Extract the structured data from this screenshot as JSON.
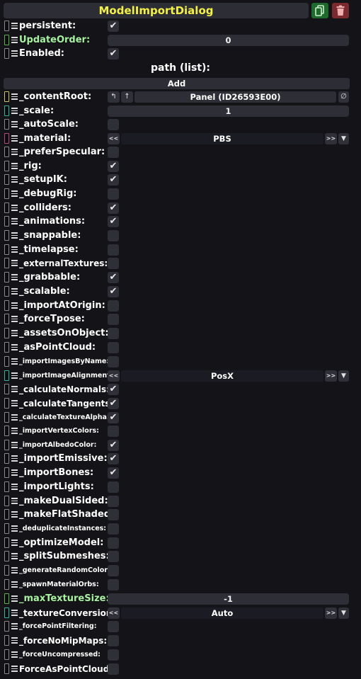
{
  "header": {
    "title": "ModelImportDialog",
    "title_color": "#f3f04a",
    "duplicate_icon": "duplicate-icon",
    "delete_icon": "trash-icon"
  },
  "persistent": {
    "label": "persistent:",
    "checked": true
  },
  "update_order": {
    "label": "UpdateOrder:",
    "value": "0"
  },
  "enabled": {
    "label": "Enabled:",
    "checked": true
  },
  "path": {
    "label": "path (list):",
    "add_label": "Add"
  },
  "content_root": {
    "label": "_contentRoot:",
    "value": "Panel (ID26593E00)",
    "clear_glyph": "∅"
  },
  "scale": {
    "label": "_scale:",
    "value": "1"
  },
  "material": {
    "label": "_material:",
    "value": "PBS"
  },
  "image_alignment": {
    "label": "_importImageAlignment:",
    "value": "PosX"
  },
  "max_texture_size": {
    "label": "_maxTextureSize:",
    "value": "-1"
  },
  "texture_conversion": {
    "label": "_textureConversion:",
    "value": "Auto"
  },
  "enum_controls": {
    "prev": "<<",
    "next": ">>",
    "dropdown": "▼"
  },
  "bools": {
    "autoScale": {
      "label": "_autoScale:",
      "checked": false
    },
    "preferSpecular": {
      "label": "_preferSpecular:",
      "checked": false
    },
    "rig": {
      "label": "_rig:",
      "checked": true
    },
    "setupIK": {
      "label": "_setupIK:",
      "checked": true
    },
    "debugRig": {
      "label": "_debugRig:",
      "checked": false
    },
    "colliders": {
      "label": "_colliders:",
      "checked": true
    },
    "animations": {
      "label": "_animations:",
      "checked": true
    },
    "snappable": {
      "label": "_snappable:",
      "checked": false
    },
    "timelapse": {
      "label": "_timelapse:",
      "checked": false
    },
    "externalTextures": {
      "label": "_externalTextures:",
      "checked": false
    },
    "grabbable": {
      "label": "_grabbable:",
      "checked": true
    },
    "scalable": {
      "label": "_scalable:",
      "checked": true
    },
    "importAtOrigin": {
      "label": "_importAtOrigin:",
      "checked": false
    },
    "forceTpose": {
      "label": "_forceTpose:",
      "checked": false
    },
    "assetsOnObject": {
      "label": "_assetsOnObject:",
      "checked": false
    },
    "asPointCloud": {
      "label": "_asPointCloud:",
      "checked": false
    },
    "importImagesByName": {
      "label": "_importImagesByName:",
      "checked": false
    },
    "calculateNormals": {
      "label": "_calculateNormals:",
      "checked": true
    },
    "calculateTangents": {
      "label": "_calculateTangents:",
      "checked": true
    },
    "calculateTextureAlpha": {
      "label": "_calculateTextureAlpha:",
      "checked": true
    },
    "importVertexColors": {
      "label": "_importVertexColors:",
      "checked": false
    },
    "importAlbedoColor": {
      "label": "_importAlbedoColor:",
      "checked": true
    },
    "importEmissive": {
      "label": "_importEmissive:",
      "checked": true
    },
    "importBones": {
      "label": "_importBones:",
      "checked": true
    },
    "importLights": {
      "label": "_importLights:",
      "checked": false
    },
    "makeDualSided": {
      "label": "_makeDualSided:",
      "checked": false
    },
    "makeFlatShaded": {
      "label": "_makeFlatShaded:",
      "checked": false
    },
    "deduplicateInstances": {
      "label": "_deduplicateInstances:",
      "checked": false
    },
    "optimizeModel": {
      "label": "_optimizeModel:",
      "checked": false
    },
    "splitSubmeshes": {
      "label": "_splitSubmeshes:",
      "checked": false
    },
    "generateRandomColors": {
      "label": "_generateRandomColors:",
      "checked": false
    },
    "spawnMaterialOrbs": {
      "label": "_spawnMaterialOrbs:",
      "checked": false
    },
    "forcePointFiltering": {
      "label": "_forcePointFiltering:",
      "checked": false
    },
    "forceNoMipMaps": {
      "label": "_forceNoMipMaps:",
      "checked": false
    },
    "forceUncompressed": {
      "label": "_forceUncompressed:",
      "checked": false
    },
    "ForceAsPointCloud": {
      "label": "ForceAsPointCloud:",
      "checked": false
    }
  },
  "colors": {
    "background": "#141418",
    "field": "#2d2e36",
    "label_highlight": "#a6f2a0",
    "duplicate_button": "#1d6a2c",
    "delete_button": "#7b2a2f"
  }
}
